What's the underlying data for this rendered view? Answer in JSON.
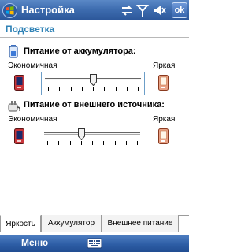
{
  "titlebar": {
    "title": "Настройка",
    "ok_label": "ok",
    "icons": [
      "windows-start-icon",
      "connectivity-icon",
      "signal-icon",
      "volume-icon"
    ]
  },
  "page": {
    "header": "Подсветка"
  },
  "battery_section": {
    "icon": "battery-icon",
    "title": "Питание от аккумулятора:",
    "left_label": "Экономичная",
    "right_label": "Яркая",
    "level": 0.5
  },
  "external_section": {
    "icon": "power-plug-icon",
    "title": "Питание от внешнего источника:",
    "left_label": "Экономичная",
    "right_label": "Яркая",
    "level": 0.375
  },
  "tabs": [
    {
      "label": "Яркость",
      "active": true
    },
    {
      "label": "Аккумулятор",
      "active": false
    },
    {
      "label": "Внешнее питание",
      "active": false
    }
  ],
  "menubar": {
    "menu_label": "Меню",
    "keyboard_icon": "keyboard-icon"
  },
  "colors": {
    "accent": "#2f82b6",
    "titlebar": "#3e6db0"
  }
}
